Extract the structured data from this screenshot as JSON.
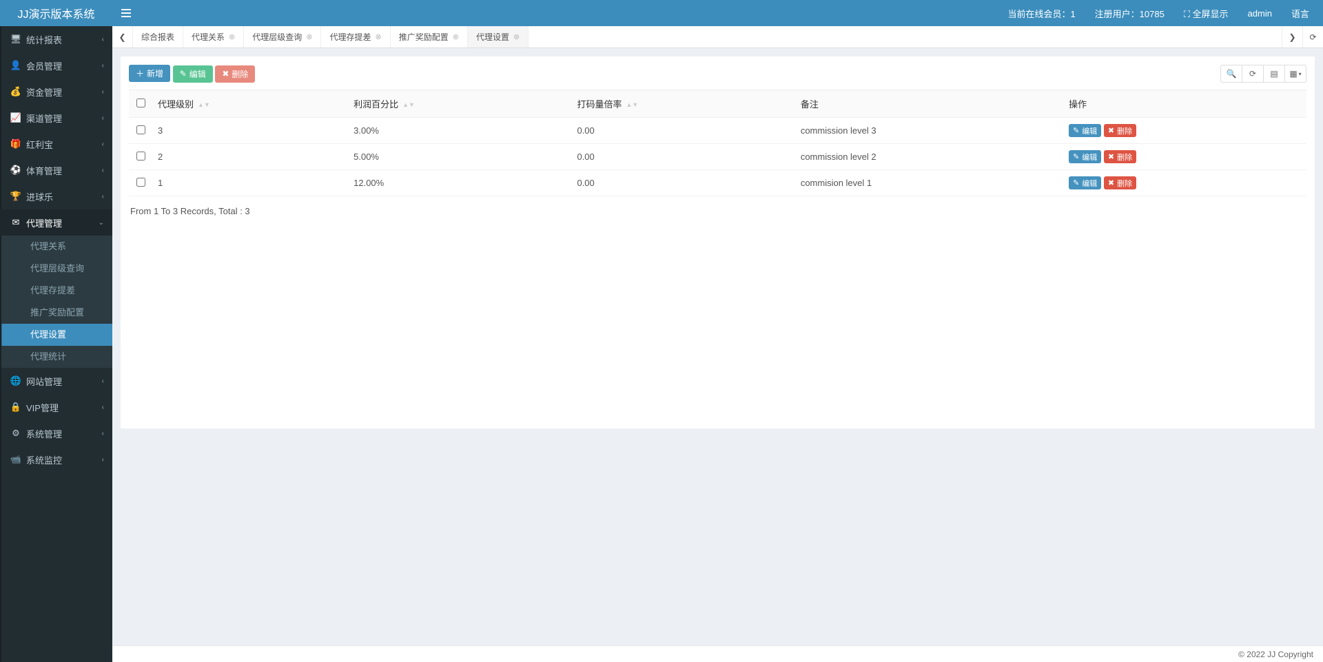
{
  "header": {
    "logo": "JJ演示版本系统",
    "online_label": "当前在线会员：1",
    "reg_label": "注册用户：10785",
    "fullscreen": "全屏显示",
    "user": "admin",
    "lang": "语言"
  },
  "sidebar": {
    "items": [
      {
        "icon": "🖥",
        "label": "统计报表"
      },
      {
        "icon": "👤",
        "label": "会员管理"
      },
      {
        "icon": "💰",
        "label": "资金管理"
      },
      {
        "icon": "📈",
        "label": "渠道管理"
      },
      {
        "icon": "🎁",
        "label": "红利宝"
      },
      {
        "icon": "⚽",
        "label": "体育管理"
      },
      {
        "icon": "🏆",
        "label": "进球乐"
      },
      {
        "icon": "✉",
        "label": "代理管理",
        "open": true,
        "children": [
          {
            "label": "代理关系"
          },
          {
            "label": "代理层级查询"
          },
          {
            "label": "代理存提差"
          },
          {
            "label": "推广奖励配置"
          },
          {
            "label": "代理设置",
            "active": true
          },
          {
            "label": "代理统计"
          }
        ]
      },
      {
        "icon": "🌐",
        "label": "网站管理"
      },
      {
        "icon": "🔒",
        "label": "VIP管理"
      },
      {
        "icon": "⚙",
        "label": "系统管理"
      },
      {
        "icon": "📹",
        "label": "系统监控"
      }
    ]
  },
  "tabs": {
    "items": [
      {
        "label": "综合报表",
        "closable": false
      },
      {
        "label": "代理关系",
        "closable": true
      },
      {
        "label": "代理层级查询",
        "closable": true
      },
      {
        "label": "代理存提差",
        "closable": true
      },
      {
        "label": "推广奖励配置",
        "closable": true
      },
      {
        "label": "代理设置",
        "closable": true,
        "active": true
      }
    ]
  },
  "toolbar": {
    "add": "新增",
    "edit": "编辑",
    "del": "删除"
  },
  "table": {
    "headers": {
      "level": "代理级别",
      "percent": "利润百分比",
      "rate": "打码量倍率",
      "note": "备注",
      "ops": "操作"
    },
    "row_edit": "编辑",
    "row_del": "删除",
    "rows": [
      {
        "level": "3",
        "percent": "3.00%",
        "rate": "0.00",
        "note": "commission level 3"
      },
      {
        "level": "2",
        "percent": "5.00%",
        "rate": "0.00",
        "note": "commission level 2"
      },
      {
        "level": "1",
        "percent": "12.00%",
        "rate": "0.00",
        "note": "commision level 1"
      }
    ]
  },
  "pager": "From 1 To 3 Records, Total : 3",
  "footer": "© 2022 JJ Copyright"
}
